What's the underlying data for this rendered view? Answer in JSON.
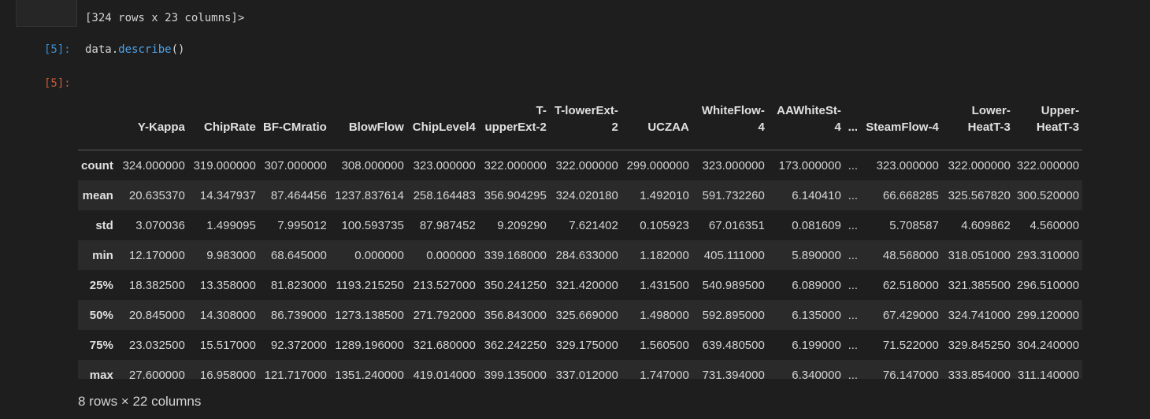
{
  "prev_output": {
    "text": "[324 rows x 23 columns]>"
  },
  "cell_in": {
    "prompt": "[5]:",
    "code_object": "data.",
    "code_method": "describe",
    "code_args": "()"
  },
  "cell_out": {
    "prompt": "[5]:"
  },
  "table": {
    "headers": [
      "",
      "Y-Kappa",
      "ChipRate",
      "BF-CMratio",
      "BlowFlow",
      "ChipLevel4",
      "T-upperExt-2",
      "T-lowerExt-2",
      "UCZAA",
      "WhiteFlow-4",
      "AAWhiteSt-4",
      "...",
      "SteamFlow-4",
      "Lower-HeatT-3",
      "Upper-HeatT-3"
    ],
    "rows": [
      [
        "count",
        "324.000000",
        "319.000000",
        "307.000000",
        "308.000000",
        "323.000000",
        "322.000000",
        "322.000000",
        "299.000000",
        "323.000000",
        "173.000000",
        "...",
        "323.000000",
        "322.000000",
        "322.000000"
      ],
      [
        "mean",
        "20.635370",
        "14.347937",
        "87.464456",
        "1237.837614",
        "258.164483",
        "356.904295",
        "324.020180",
        "1.492010",
        "591.732260",
        "6.140410",
        "...",
        "66.668285",
        "325.567820",
        "300.520000"
      ],
      [
        "std",
        "3.070036",
        "1.499095",
        "7.995012",
        "100.593735",
        "87.987452",
        "9.209290",
        "7.621402",
        "0.105923",
        "67.016351",
        "0.081609",
        "...",
        "5.708587",
        "4.609862",
        "4.560000"
      ],
      [
        "min",
        "12.170000",
        "9.983000",
        "68.645000",
        "0.000000",
        "0.000000",
        "339.168000",
        "284.633000",
        "1.182000",
        "405.111000",
        "5.890000",
        "...",
        "48.568000",
        "318.051000",
        "293.310000"
      ],
      [
        "25%",
        "18.382500",
        "13.358000",
        "81.823000",
        "1193.215250",
        "213.527000",
        "350.241250",
        "321.420000",
        "1.431500",
        "540.989500",
        "6.089000",
        "...",
        "62.518000",
        "321.385500",
        "296.510000"
      ],
      [
        "50%",
        "20.845000",
        "14.308000",
        "86.739000",
        "1273.138500",
        "271.792000",
        "356.843000",
        "325.669000",
        "1.498000",
        "592.895000",
        "6.135000",
        "...",
        "67.429000",
        "324.741000",
        "299.120000"
      ],
      [
        "75%",
        "23.032500",
        "15.517000",
        "92.372000",
        "1289.196000",
        "321.680000",
        "362.242250",
        "329.175000",
        "1.560500",
        "639.480500",
        "6.199000",
        "...",
        "71.522000",
        "329.845250",
        "304.240000"
      ],
      [
        "max",
        "27.600000",
        "16.958000",
        "121.717000",
        "1351.240000",
        "419.014000",
        "399.135000",
        "337.012000",
        "1.747000",
        "731.394000",
        "6.340000",
        "...",
        "76.147000",
        "333.854000",
        "311.140000"
      ]
    ]
  },
  "summary": {
    "text": "8 rows × 22 columns"
  }
}
